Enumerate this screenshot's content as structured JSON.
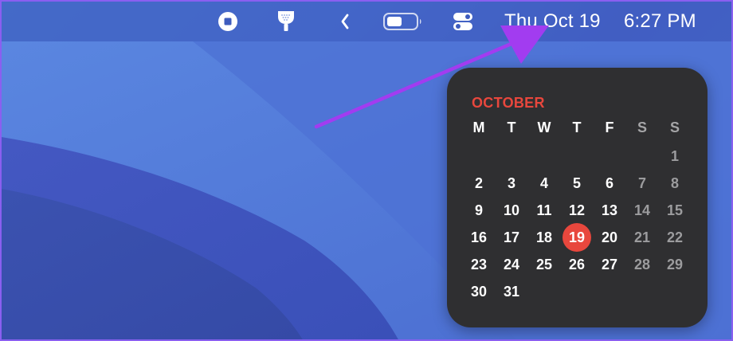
{
  "menubar": {
    "icons": [
      {
        "name": "screen-record-stop-icon"
      },
      {
        "name": "shower-head-icon"
      },
      {
        "name": "chevron-left-icon"
      },
      {
        "name": "battery-icon"
      },
      {
        "name": "control-center-icon"
      }
    ],
    "clock_date": "Thu Oct 19",
    "clock_time": "6:27 PM"
  },
  "calendar": {
    "month": "OCTOBER",
    "weekdays": [
      "M",
      "T",
      "W",
      "T",
      "F",
      "S",
      "S"
    ],
    "weeks": [
      [
        "",
        "",
        "",
        "",
        "",
        "",
        "1"
      ],
      [
        "2",
        "3",
        "4",
        "5",
        "6",
        "7",
        "8"
      ],
      [
        "9",
        "10",
        "11",
        "12",
        "13",
        "14",
        "15"
      ],
      [
        "16",
        "17",
        "18",
        "19",
        "20",
        "21",
        "22"
      ],
      [
        "23",
        "24",
        "25",
        "26",
        "27",
        "28",
        "29"
      ],
      [
        "30",
        "31",
        "",
        "",
        "",
        "",
        ""
      ]
    ],
    "today": "19",
    "colors": {
      "accent": "#e8473d",
      "widget_bg": "#2f2f31",
      "weekday_text": "#ffffff",
      "weekend_text": "#9c9c9e"
    }
  },
  "annotation": {
    "color": "#a23cf0"
  }
}
